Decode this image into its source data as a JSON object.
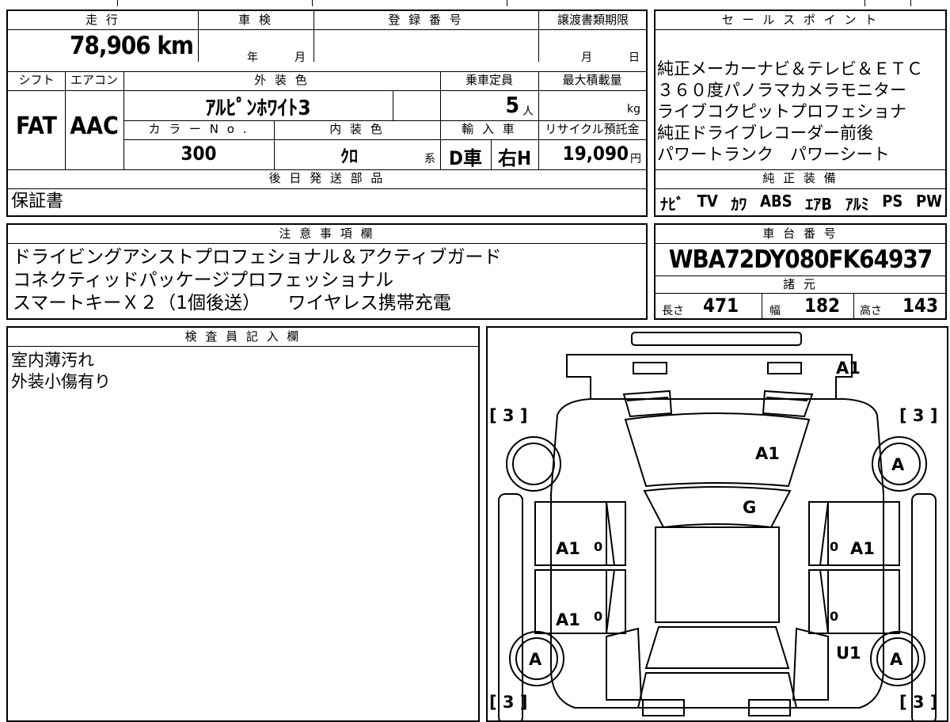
{
  "sheet": {
    "labels": {
      "mileage": "走 行",
      "inspection": "車 検",
      "registration": "登 録 番 号",
      "transfer_deadline": "譲渡書類期限",
      "shift": "シフト",
      "aircon": "エアコン",
      "exterior_color": "外 装 色",
      "capacity": "乗車定員",
      "max_load": "最大積載量",
      "color_no": "カ ラ ー N o .",
      "interior_color": "内 装 色",
      "import": "輸 入 車",
      "recycle": "リサイクル預託金",
      "later_parts": "後 日 発 送 部 品",
      "sales_points": "セ ー ル ス ポ イ ン ト",
      "genuine_equipment": "純 正 装 備",
      "notes": "注 意 事 項 欄",
      "chassis": "車 台 番 号",
      "specs": "諸 元",
      "inspector": "検 査 員 記 入 欄"
    },
    "units": {
      "year": "年",
      "month": "月",
      "month2": "月",
      "day": "日",
      "person": "人",
      "kg": "kg",
      "series": "系",
      "yen": "円",
      "length": "長さ",
      "width": "幅",
      "height": "高さ"
    },
    "values": {
      "mileage": "78,906 km",
      "shift": "FAT",
      "aircon": "AAC",
      "exterior_color": "ｱﾙﾋﾟﾝﾎﾜｲﾄ3",
      "capacity": "5",
      "color_no": "300",
      "interior_color": "ｸﾛ",
      "import": "D車",
      "steering": "右H",
      "recycle": "19,090",
      "later_parts": "保証書",
      "chassis": "WBA72DY080FK64937",
      "length": "471",
      "width": "182",
      "height": "143"
    },
    "sales_points": [
      "純正メーカーナビ＆テレビ＆ＥＴＣ",
      "３６０度パノラマカメラモニター",
      "ライブコクピットプロフェショナ",
      "純正ドライブレコーダー前後",
      "パワートランク　パワーシート"
    ],
    "equipment": [
      "ﾅﾋﾞ",
      "TV",
      "ｶﾜ",
      "ABS",
      "ｴｱB",
      "ｱﾙﾐ",
      "PS",
      "PW"
    ],
    "notes": [
      "ドライビングアシストプロフェショナル＆アクティブガード",
      "コネクティッドパッケージプロフェッショナル",
      "スマートキーＸ２（1個後送）　　ワイヤレス携帯充電"
    ],
    "inspector_notes": [
      "室内薄汚れ",
      "外装小傷有り"
    ],
    "diagram": {
      "tire_tl": "[ 3 ]",
      "tire_tr": "[ 3 ]",
      "tire_bl": "[ 3 ]",
      "tire_br": "[ 3 ]",
      "wheel_tl": "",
      "wheel_tr": "A",
      "wheel_bl": "A",
      "wheel_br": "A",
      "bumper": "A1",
      "hood": "A1",
      "windshield": "G",
      "front_door_l": "A1",
      "rear_door_l": "A1",
      "front_door_r": "A1",
      "rear_quarter_r": "U1",
      "zero_fl": "0",
      "zero_rl": "0",
      "zero_fr": "0",
      "zero_rr": "0"
    }
  }
}
